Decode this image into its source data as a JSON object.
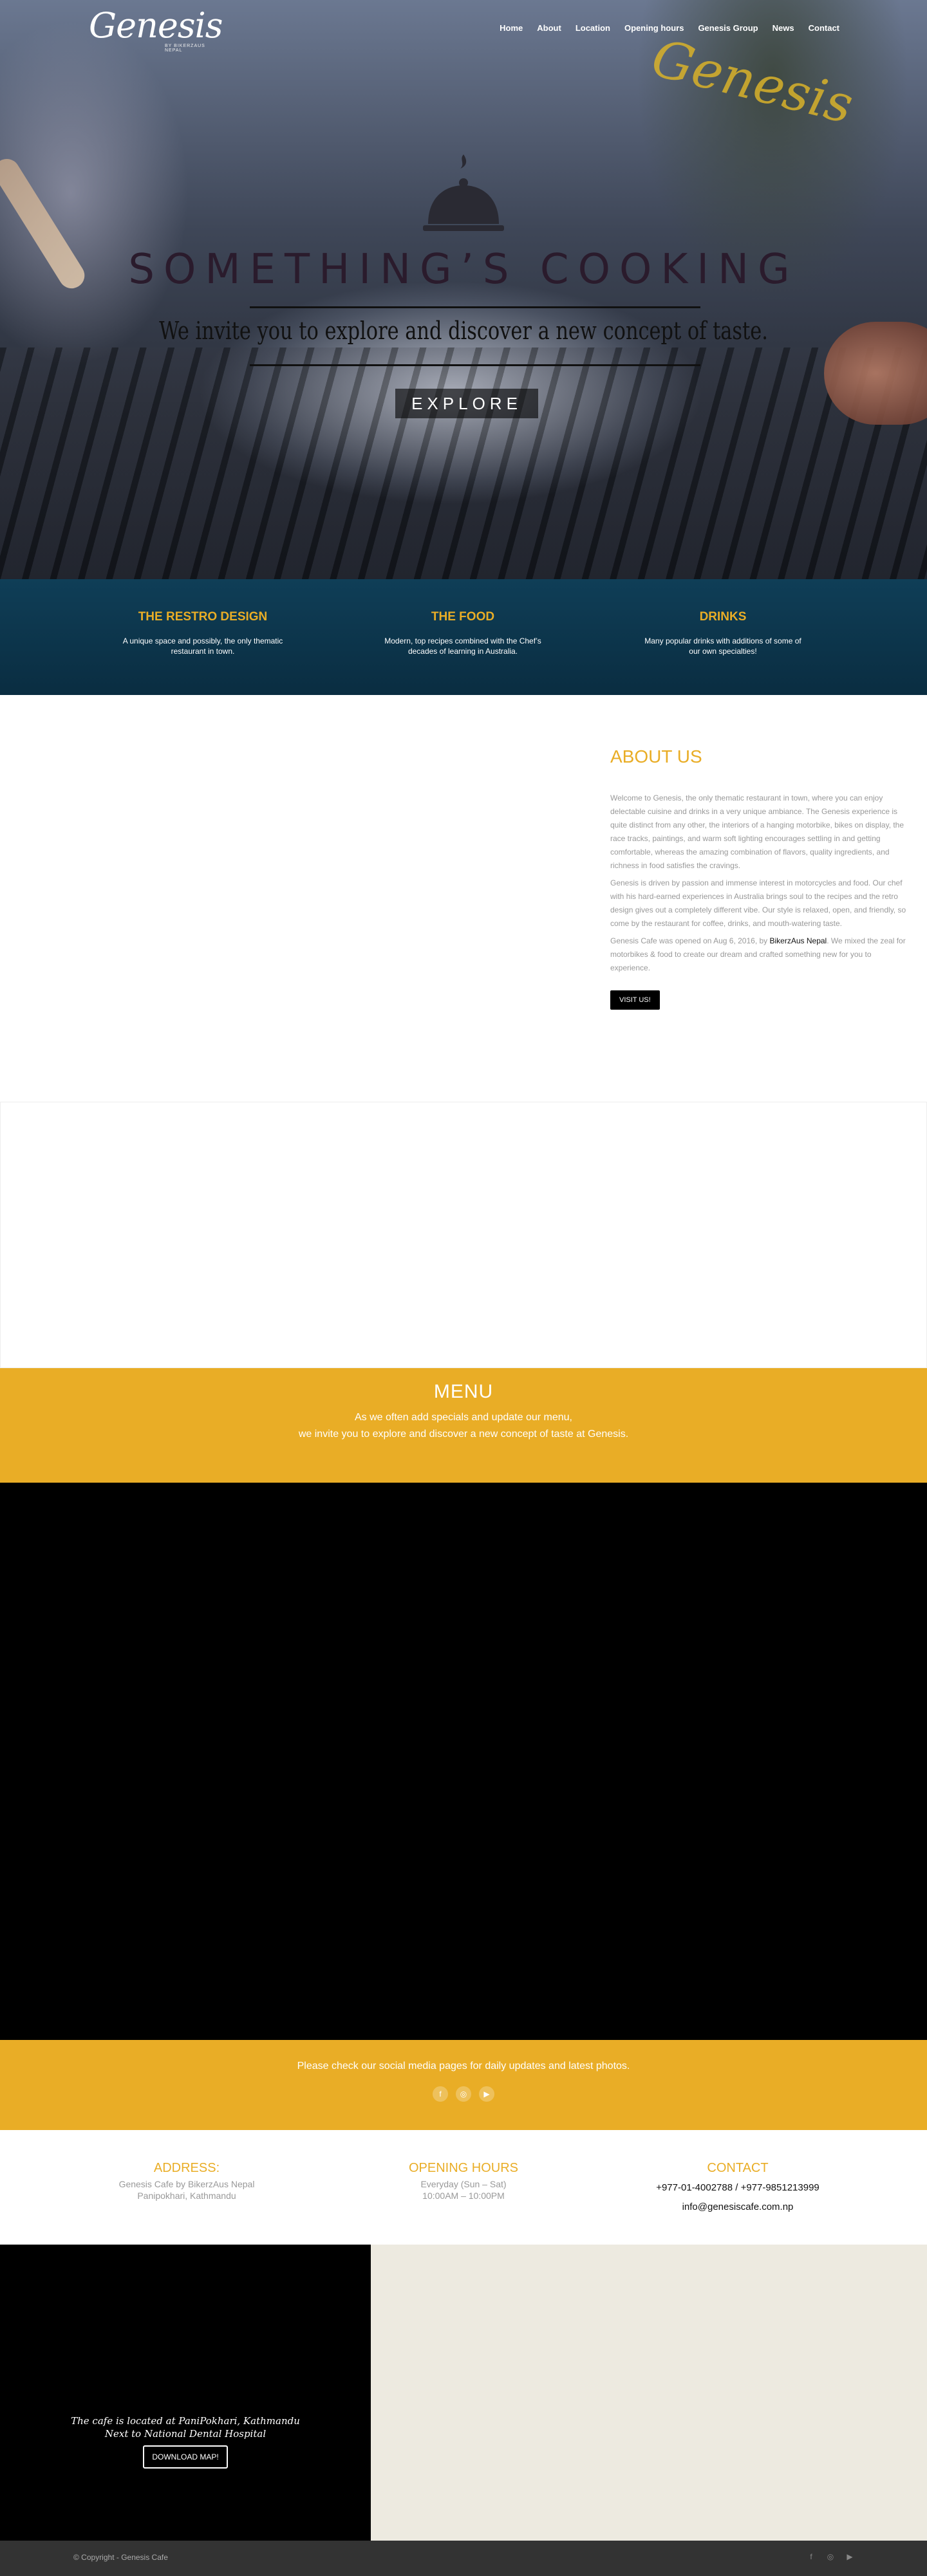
{
  "brand": {
    "logo": "Genesis",
    "tagline": "by BikerzAus Nepal"
  },
  "nav": {
    "items": [
      "Home",
      "About",
      "Location",
      "Opening hours",
      "Genesis Group",
      "News",
      "Contact"
    ]
  },
  "hero": {
    "title": "SOMETHING’S COOKING",
    "subtitle": "We invite you to explore and discover a new concept of taste.",
    "button": "EXPLORE"
  },
  "features": [
    {
      "title": "THE RESTRO DESIGN",
      "text": "A unique space and possibly, the only thematic restaurant in town."
    },
    {
      "title": "THE FOOD",
      "text": "Modern, top recipes combined with the Chef’s decades of learning in Australia."
    },
    {
      "title": "DRINKS",
      "text": "Many popular drinks with additions of some of our own specialties!"
    }
  ],
  "about": {
    "heading": "ABOUT US",
    "p1": "Welcome to Genesis, the only thematic restaurant in town, where you can enjoy delectable cuisine and drinks in a very unique ambiance. The Genesis experience is quite distinct from any other, the interiors of a hanging motorbike, bikes on display, the race tracks, paintings, and warm soft lighting encourages settling in and getting comfortable, whereas the amazing combination of flavors, quality ingredients, and richness in food satisfies the cravings.",
    "p2": "Genesis is driven by passion and immense interest in motorcycles and food. Our chef with his hard-earned experiences in Australia brings soul to the recipes and the retro design gives out a completely different vibe. Our style is relaxed, open, and friendly, so come by the restaurant for coffee, drinks, and mouth-watering taste.",
    "p3_before": "Genesis Cafe was opened on Aug 6, 2016, by ",
    "p3_link": "BikerzAus Nepal",
    "p3_after": ". We mixed the zeal for motorbikes & food to create our dream and crafted something new for you to experience.",
    "button": "VISIT US!"
  },
  "menu": {
    "heading": "MENU",
    "line1": "As we often add specials and update our menu,",
    "line2": "we invite you to explore and discover a new concept of taste at Genesis."
  },
  "social": {
    "text": "Please check our social media pages for daily updates and latest photos.",
    "icons": [
      "facebook-icon",
      "instagram-icon",
      "youtube-icon"
    ]
  },
  "info": {
    "address": {
      "heading": "ADDRESS:",
      "line1": "Genesis Cafe by BikerzAus Nepal",
      "line2": "Panipokhari, Kathmandu"
    },
    "hours": {
      "heading": "OPENING HOURS",
      "line1": "Everyday (Sun – Sat)",
      "line2": "10:00AM – 10:00PM"
    },
    "contact": {
      "heading": "CONTACT",
      "phone": "+977-01-4002788 / +977-9851213999",
      "email": "info@genesiscafe.com.np"
    }
  },
  "map": {
    "line1": "The cafe is located at PaniPokhari, Kathmandu",
    "line2": "Next to National Dental Hospital",
    "button": "DOWNLOAD MAP!"
  },
  "footer": {
    "copyright": "© Copyright - Genesis Cafe"
  },
  "colors": {
    "accent": "#e9ad26",
    "navy": "#0f3e57",
    "dark": "#333333"
  }
}
